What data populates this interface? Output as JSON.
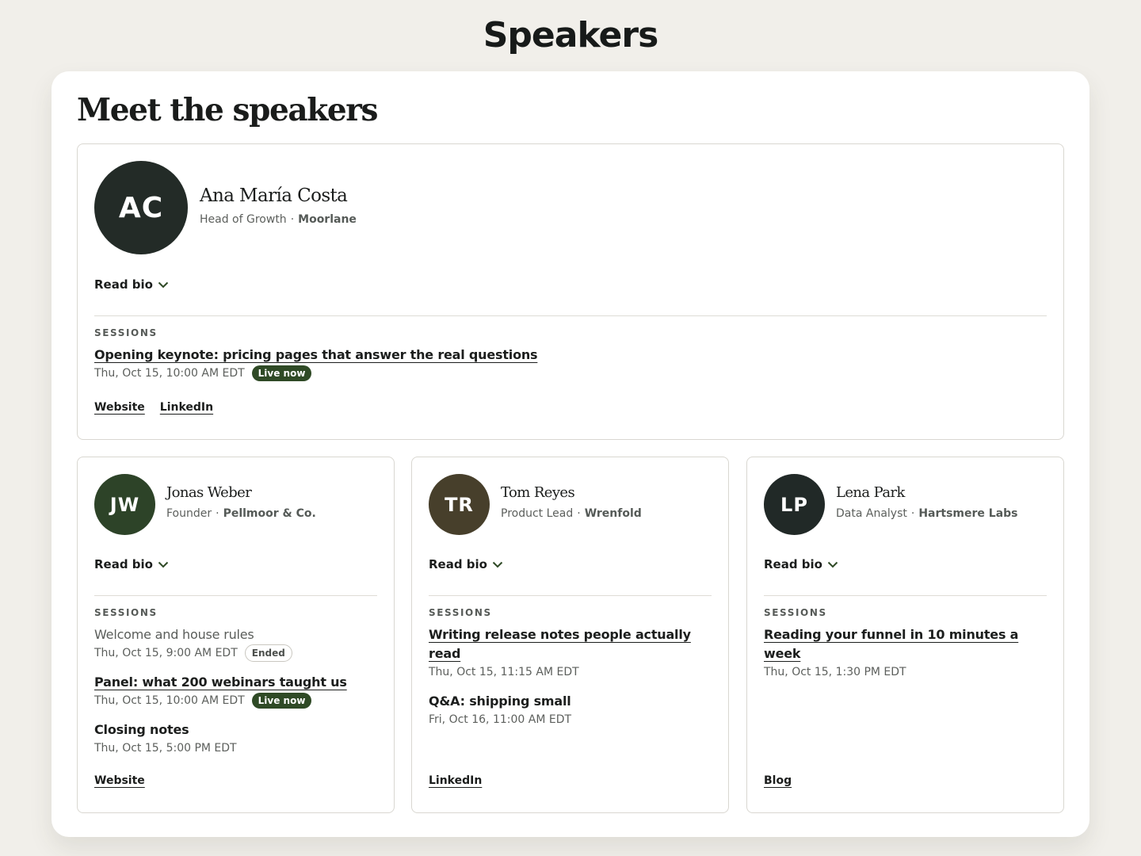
{
  "page": {
    "heading": "Speakers"
  },
  "section": {
    "title": "Meet the speakers"
  },
  "ui": {
    "read_bio": "Read bio",
    "sessions_label": "SESSIONS",
    "role_separator": "·"
  },
  "colors": {
    "live_badge": "#2f4a26",
    "avatar_ac": "#232b27",
    "avatar_jw": "#2d4328",
    "avatar_tr": "#473f2b",
    "avatar_lp": "#212927"
  },
  "speakers": [
    {
      "initials": "AC",
      "name": "Ana María Costa",
      "role": "Head of Growth",
      "company": "Moorlane",
      "sessions": [
        {
          "title": "Opening keynote: pricing pages that answer the real questions",
          "time": "Thu, Oct 15, 10:00 AM EDT",
          "badge": "Live now"
        }
      ],
      "links": [
        "Website",
        "LinkedIn"
      ]
    },
    {
      "initials": "JW",
      "name": "Jonas Weber",
      "role": "Founder",
      "company": "Pellmoor & Co.",
      "sessions": [
        {
          "title": "Welcome and house rules",
          "time": "Thu, Oct 15, 9:00 AM EDT",
          "badge": "Ended"
        },
        {
          "title": "Panel: what 200 webinars taught us",
          "time": "Thu, Oct 15, 10:00 AM EDT",
          "badge": "Live now"
        },
        {
          "title": "Closing notes",
          "time": "Thu, Oct 15, 5:00 PM EDT"
        }
      ],
      "links": [
        "Website"
      ]
    },
    {
      "initials": "TR",
      "name": "Tom Reyes",
      "role": "Product Lead",
      "company": "Wrenfold",
      "sessions": [
        {
          "title": "Writing release notes people actually read",
          "time": "Thu, Oct 15, 11:15 AM EDT"
        },
        {
          "title": "Q&A: shipping small",
          "time": "Fri, Oct 16, 11:00 AM EDT"
        }
      ],
      "links": [
        "LinkedIn"
      ]
    },
    {
      "initials": "LP",
      "name": "Lena Park",
      "role": "Data Analyst",
      "company": "Hartsmere Labs",
      "sessions": [
        {
          "title": "Reading your funnel in 10 minutes a week",
          "time": "Thu, Oct 15, 1:30 PM EDT"
        }
      ],
      "links": [
        "Blog"
      ]
    }
  ]
}
